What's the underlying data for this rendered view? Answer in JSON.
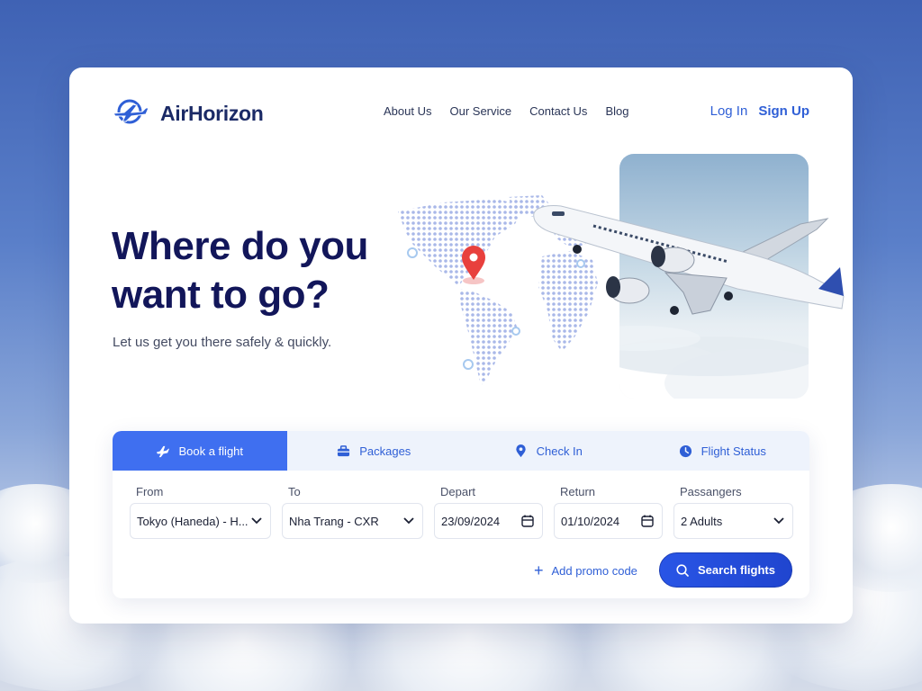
{
  "brand": {
    "name": "AirHorizon",
    "logo_icon": "plane-globe-icon",
    "color": "#1b2a66"
  },
  "nav": {
    "items": [
      "About Us",
      "Our Service",
      "Contact Us",
      "Blog"
    ]
  },
  "auth": {
    "login": "Log In",
    "signup": "Sign Up"
  },
  "hero": {
    "title_line1": "Where do you",
    "title_line2": "want to go?",
    "subtitle": "Let us get you there safely & quickly."
  },
  "booking": {
    "tabs": [
      {
        "label": "Book a flight",
        "icon": "plane-icon",
        "active": true
      },
      {
        "label": "Packages",
        "icon": "briefcase-icon",
        "active": false
      },
      {
        "label": "Check In",
        "icon": "location-pin-icon",
        "active": false
      },
      {
        "label": "Flight Status",
        "icon": "clock-icon",
        "active": false
      }
    ],
    "from": {
      "label": "From",
      "value": "Tokyo (Haneda) - H..."
    },
    "to": {
      "label": "To",
      "value": "Nha Trang - CXR"
    },
    "depart": {
      "label": "Depart",
      "value": "23/09/2024"
    },
    "return": {
      "label": "Return",
      "value": "01/10/2024"
    },
    "passengers": {
      "label": "Passangers",
      "value": "2 Adults"
    },
    "promo": "Add promo code",
    "search": "Search flights"
  },
  "colors": {
    "accent": "#3f6ff0",
    "heading": "#12165a",
    "link": "#2f5fd6"
  }
}
